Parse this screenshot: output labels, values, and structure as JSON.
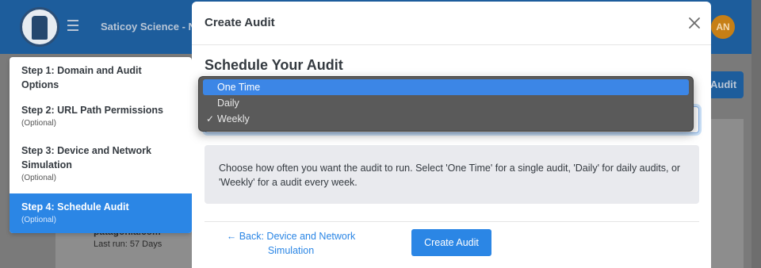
{
  "app": {
    "title": "Saticoy Science - N",
    "avatar_initials": "AN",
    "bg_audit_button": "Audit",
    "bg_card_title": "patagonia.com",
    "bg_card_last_run": "Last run: 57 Days"
  },
  "steps": [
    {
      "title": "Step 1: Domain and Audit Options",
      "optional": ""
    },
    {
      "title": "Step 2: URL Path Permissions",
      "optional": "(Optional)"
    },
    {
      "title": "Step 3: Device and Network Simulation",
      "optional": "(Optional)"
    },
    {
      "title": "Step 4: Schedule Audit",
      "optional": "(Optional)"
    }
  ],
  "modal": {
    "title": "Create Audit",
    "section_title": "Schedule Your Audit",
    "info_text": "Choose how often you want the audit to run. Select 'One Time' for a single audit, 'Daily' for daily audits, or 'Weekly' for a audit every week.",
    "back_label": "← Back: Device and Network Simulation",
    "create_label": "Create Audit"
  },
  "dropdown": {
    "options": [
      "One Time",
      "Daily",
      "Weekly"
    ],
    "highlighted": "One Time",
    "selected": "Weekly"
  },
  "colors": {
    "accent": "#2b86e5",
    "header": "#1d5d9c",
    "avatar": "#c67f16"
  }
}
